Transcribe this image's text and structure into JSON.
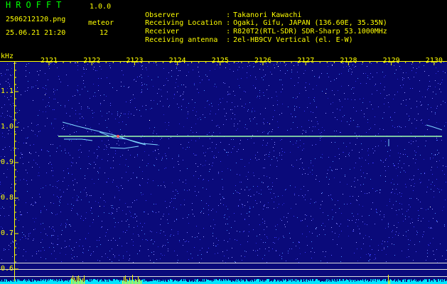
{
  "header": {
    "brand": "HROFFT",
    "version": "1.0.0",
    "filename": "2506212120.png",
    "datetime": "25.06.21 21:20",
    "meteor_label": "meteor",
    "meteor_count": "12",
    "info": [
      {
        "label": "Observer",
        "value": "Takanori Kawachi"
      },
      {
        "label": "Receiving Location",
        "value": "Ogaki, Gifu, JAPAN (136.60E, 35.35N)"
      },
      {
        "label": "Receiver",
        "value": "R820T2(RTL-SDR) SDR-Sharp 53.1000MHz"
      },
      {
        "label": "Receiving antenna",
        "value": "2el-HB9CV Vertical (el. E-W)"
      }
    ]
  },
  "spectrogram": {
    "y_unit": "kHz",
    "x_ticks": [
      "2121",
      "2122",
      "2123",
      "2124",
      "2125",
      "2126",
      "2127",
      "2128",
      "2129",
      "2130"
    ],
    "y_ticks": [
      "1.1",
      "1.0",
      "0.9",
      "0.8",
      "0.7",
      "0.6"
    ],
    "colors": {
      "background": "#0a0a7a",
      "axis": "#ffff00",
      "carrier": "#9fffaf",
      "echo": "#7fd7ff",
      "noise_floor": "#00e5ff",
      "burst": "#ffff00"
    }
  }
}
